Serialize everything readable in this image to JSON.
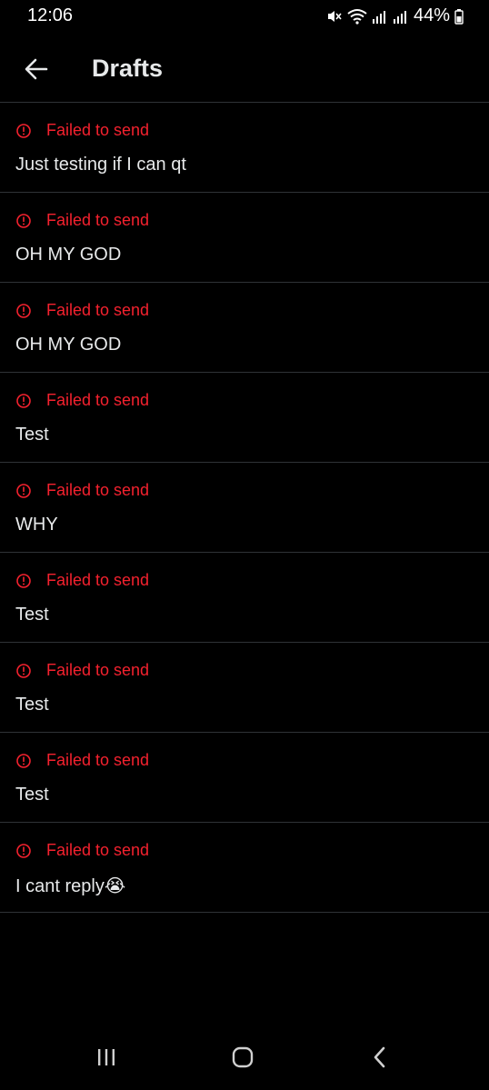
{
  "status_bar": {
    "time": "12:06",
    "battery": "44%",
    "icons": [
      "mute-icon",
      "wifi-icon",
      "signal-icon",
      "signal-icon",
      "battery-icon"
    ]
  },
  "header": {
    "title": "Drafts",
    "back_icon": "arrow-left-icon"
  },
  "colors": {
    "background": "#000000",
    "text": "#e7e9ea",
    "error": "#f4212e",
    "divider": "#2f3336"
  },
  "drafts": [
    {
      "status": "Failed to send",
      "text": "Just testing if I can qt"
    },
    {
      "status": "Failed to send",
      "text": "OH MY GOD"
    },
    {
      "status": "Failed to send",
      "text": "OH MY GOD"
    },
    {
      "status": "Failed to send",
      "text": "Test"
    },
    {
      "status": "Failed to send",
      "text": "WHY"
    },
    {
      "status": "Failed to send",
      "text": "Test"
    },
    {
      "status": "Failed to send",
      "text": "Test"
    },
    {
      "status": "Failed to send",
      "text": "Test"
    },
    {
      "status": "Failed to send",
      "text": "I cant reply😭"
    }
  ],
  "nav_bar": {
    "buttons": [
      "recents-icon",
      "home-icon",
      "back-icon"
    ]
  }
}
